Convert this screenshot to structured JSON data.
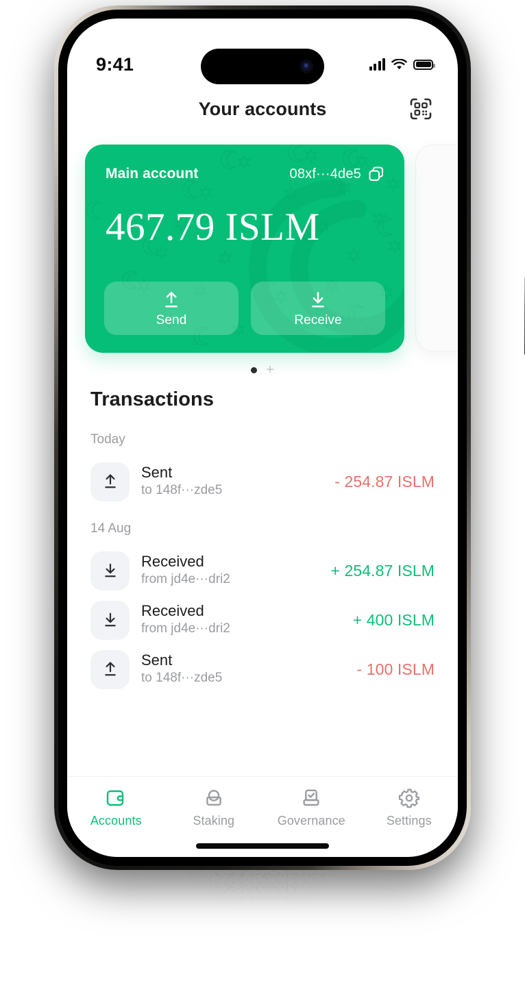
{
  "status_bar": {
    "time": "9:41",
    "signal_icon": "cellular-signal-icon",
    "wifi_icon": "wifi-icon",
    "battery_icon": "battery-icon"
  },
  "header": {
    "title": "Your accounts",
    "scan_icon": "qr-scan-icon"
  },
  "card": {
    "account_name": "Main account",
    "address": "08xf···4de5",
    "copy_icon": "copy-icon",
    "balance": "467.79 ISLM",
    "accent_color": "#06be77",
    "actions": [
      {
        "label": "Send",
        "icon": "arrow-up-export-icon"
      },
      {
        "label": "Receive",
        "icon": "arrow-down-import-icon"
      }
    ]
  },
  "pager": {
    "active_dot": "●",
    "add_label": "+"
  },
  "transactions": {
    "title": "Transactions",
    "groups": [
      {
        "label": "Today",
        "items": [
          {
            "kind": "Sent",
            "peer_prefix": "to",
            "peer": "148f···zde5",
            "amount": "- 254.87 ISLM",
            "direction": "negative",
            "icon": "arrow-up-export-icon"
          }
        ]
      },
      {
        "label": "14 Aug",
        "items": [
          {
            "kind": "Received",
            "peer_prefix": "from",
            "peer": "jd4e···dri2",
            "amount": "+ 254.87 ISLM",
            "direction": "positive",
            "icon": "arrow-down-import-icon"
          },
          {
            "kind": "Received",
            "peer_prefix": "from",
            "peer": "jd4e···dri2",
            "amount": "+ 400 ISLM",
            "direction": "positive",
            "icon": "arrow-down-import-icon"
          },
          {
            "kind": "Sent",
            "peer_prefix": "to",
            "peer": "148f···zde5",
            "amount": "- 100 ISLM",
            "direction": "negative",
            "icon": "arrow-up-export-icon"
          }
        ]
      }
    ],
    "positive_color": "#0fbe77",
    "negative_color": "#e8706b"
  },
  "tabbar": {
    "active_color": "#0fbe77",
    "inactive_color": "#9a9ca1",
    "tabs": [
      {
        "label": "Accounts",
        "icon": "wallet-icon",
        "active": true
      },
      {
        "label": "Staking",
        "icon": "staking-icon",
        "active": false
      },
      {
        "label": "Governance",
        "icon": "governance-icon",
        "active": false
      },
      {
        "label": "Settings",
        "icon": "gear-icon",
        "active": false
      }
    ]
  }
}
